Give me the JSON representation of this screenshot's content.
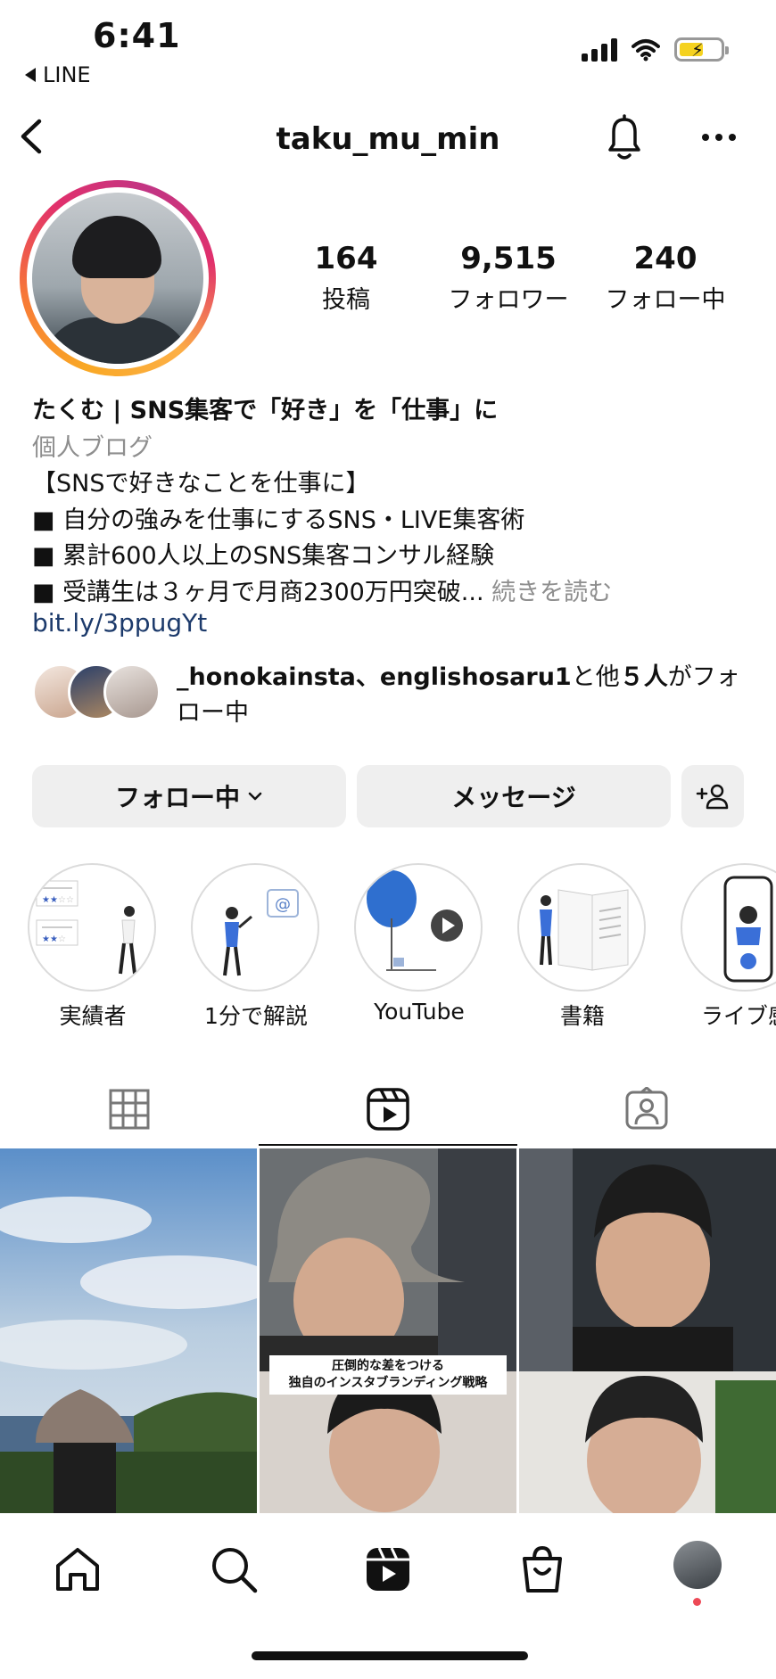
{
  "status_bar": {
    "time": "6:41",
    "back_app": "LINE"
  },
  "header": {
    "username": "taku_mu_min"
  },
  "profile": {
    "stats": [
      {
        "value": "164",
        "label": "投稿"
      },
      {
        "value": "9,515",
        "label": "フォロワー"
      },
      {
        "value": "240",
        "label": "フォロー中"
      }
    ],
    "name": "たくむ | SNS集客で「好き」を「仕事」に",
    "category": "個人ブログ",
    "bio_lines": [
      "【SNSで好きなことを仕事に】",
      "■ 自分の強みを仕事にするSNS・LIVE集客術",
      "■ 累計600人以上のSNS集客コンサル経験",
      "■ 受講生は３ヶ月で月商2300万円突破..."
    ],
    "bio_more": "続きを読む",
    "link": "bit.ly/3ppugYt",
    "mutual": {
      "names": "_honokainsta、englishosaru1",
      "suffix_1": "と他",
      "count": "５人",
      "suffix_2": "がフォロー中"
    }
  },
  "actions": {
    "following_label": "フォロー中",
    "message_label": "メッセージ"
  },
  "highlights": [
    {
      "label": "実績者"
    },
    {
      "label": "1分で解説"
    },
    {
      "label": "YouTube"
    },
    {
      "label": "書籍"
    },
    {
      "label": "ライブ感"
    }
  ],
  "grid": {
    "caption_line1": "圧倒的な差をつける",
    "caption_line2": "独自のインスタブランディング戦略"
  },
  "colors": {
    "link": "#1c3a6b",
    "secondary_text": "#8e8e8e",
    "button_bg": "#efefef",
    "notification_dot": "#ed4956"
  }
}
